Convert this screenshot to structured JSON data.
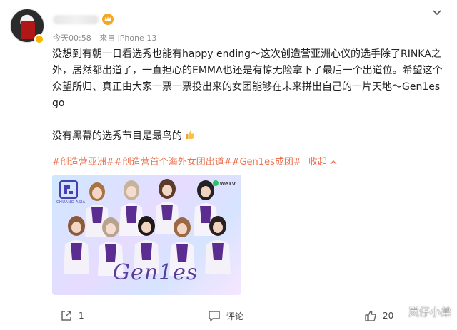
{
  "post": {
    "user": {
      "verified_badge": "v-badge-icon",
      "vip_icon": "vip-crown-icon"
    },
    "meta": {
      "time": "今天00:58",
      "source": "来自 iPhone 13"
    },
    "line1": "没想到有朝一日看选秀也能有happy ending～这次创造营亚洲心仪的选手除了RINKA之外，居然都出道了，一直担心的EMMA也还是有惊无险拿下了最后一个出道位。希望这个众望所归、真正由大家一票一票投出来的女团能够在未来拼出自己的一片天地～Gen1es go",
    "line2": "没有黑幕的选秀节目是最鸟的",
    "tags": [
      "#创造营亚洲#",
      "#创造营首个海外女团出道#",
      "#Gen1es成团#"
    ],
    "collapse_label": "收起",
    "image": {
      "logo_text": "CHUANG ASIA",
      "wetv_label": "WeTV",
      "title": "Gen1es"
    }
  },
  "actions": {
    "share_count": "1",
    "comment_label": "评论",
    "like_count": "20"
  },
  "watermark": "岚仔小弟",
  "colors": {
    "tag": "#eb7350",
    "meta": "#8a8a8a"
  }
}
